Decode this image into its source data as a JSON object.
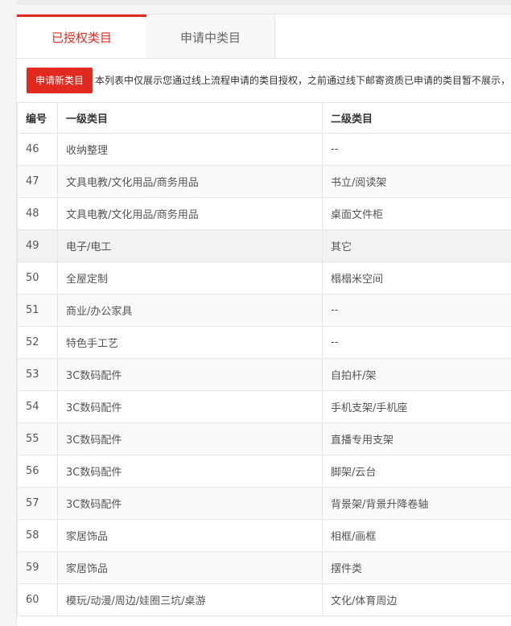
{
  "tabs": [
    {
      "label": "已授权类目"
    },
    {
      "label": "申请中类目"
    }
  ],
  "apply_button": "申请新类目",
  "notice": "本列表中仅展示您通过线上流程申请的类目授权，之前通过线下邮寄资质已申请的类目暂不展示，",
  "table": {
    "headers": [
      "编号",
      "一级类目",
      "二级类目"
    ],
    "rows": [
      [
        "46",
        "收纳整理",
        "--"
      ],
      [
        "47",
        "文具电教/文化用品/商务用品",
        "书立/阅读架"
      ],
      [
        "48",
        "文具电教/文化用品/商务用品",
        "桌面文件柜"
      ],
      [
        "49",
        "电子/电工",
        "其它"
      ],
      [
        "50",
        "全屋定制",
        "榻榻米空间"
      ],
      [
        "51",
        "商业/办公家具",
        "--"
      ],
      [
        "52",
        "特色手工艺",
        "--"
      ],
      [
        "53",
        "3C数码配件",
        "自拍杆/架"
      ],
      [
        "54",
        "3C数码配件",
        "手机支架/手机座"
      ],
      [
        "55",
        "3C数码配件",
        "直播专用支架"
      ],
      [
        "56",
        "3C数码配件",
        "脚架/云台"
      ],
      [
        "57",
        "3C数码配件",
        "背景架/背景升降卷轴"
      ],
      [
        "58",
        "家居饰品",
        "相框/画框"
      ],
      [
        "59",
        "家居饰品",
        "摆件类"
      ],
      [
        "60",
        "模玩/动漫/周边/娃圈三坑/桌游",
        "文化/体育周边"
      ]
    ]
  },
  "colors": {
    "accent": "#e0291f"
  }
}
